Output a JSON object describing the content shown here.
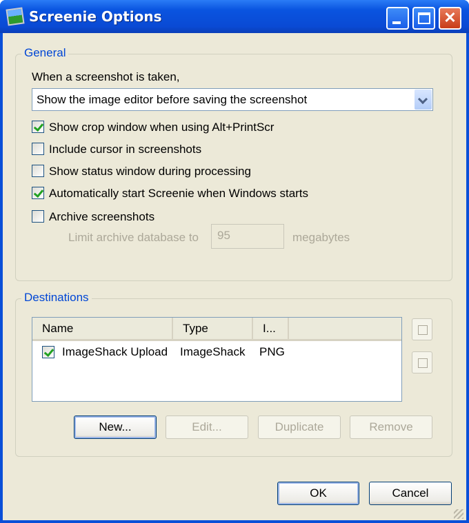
{
  "window": {
    "title": "Screenie Options"
  },
  "general": {
    "legend": "General",
    "when_label": "When a screenshot is taken,",
    "action_selected": "Show the image editor before saving the screenshot",
    "options": [
      {
        "label": "Show crop window when using Alt+PrintScr",
        "checked": true
      },
      {
        "label": "Include cursor in screenshots",
        "checked": false
      },
      {
        "label": "Show status window during processing",
        "checked": false
      },
      {
        "label": "Automatically start Screenie when Windows starts",
        "checked": true
      },
      {
        "label": "Archive screenshots",
        "checked": false
      }
    ],
    "limit_label": "Limit archive database to",
    "limit_value": "95",
    "limit_unit": "megabytes"
  },
  "destinations": {
    "legend": "Destinations",
    "columns": [
      "Name",
      "Type",
      "I..."
    ],
    "rows": [
      {
        "name": "ImageShack Upload",
        "type": "ImageShack",
        "format": "PNG",
        "checked": true
      }
    ],
    "buttons": {
      "new": "New...",
      "edit": "Edit...",
      "duplicate": "Duplicate",
      "remove": "Remove"
    }
  },
  "footer": {
    "ok": "OK",
    "cancel": "Cancel"
  }
}
